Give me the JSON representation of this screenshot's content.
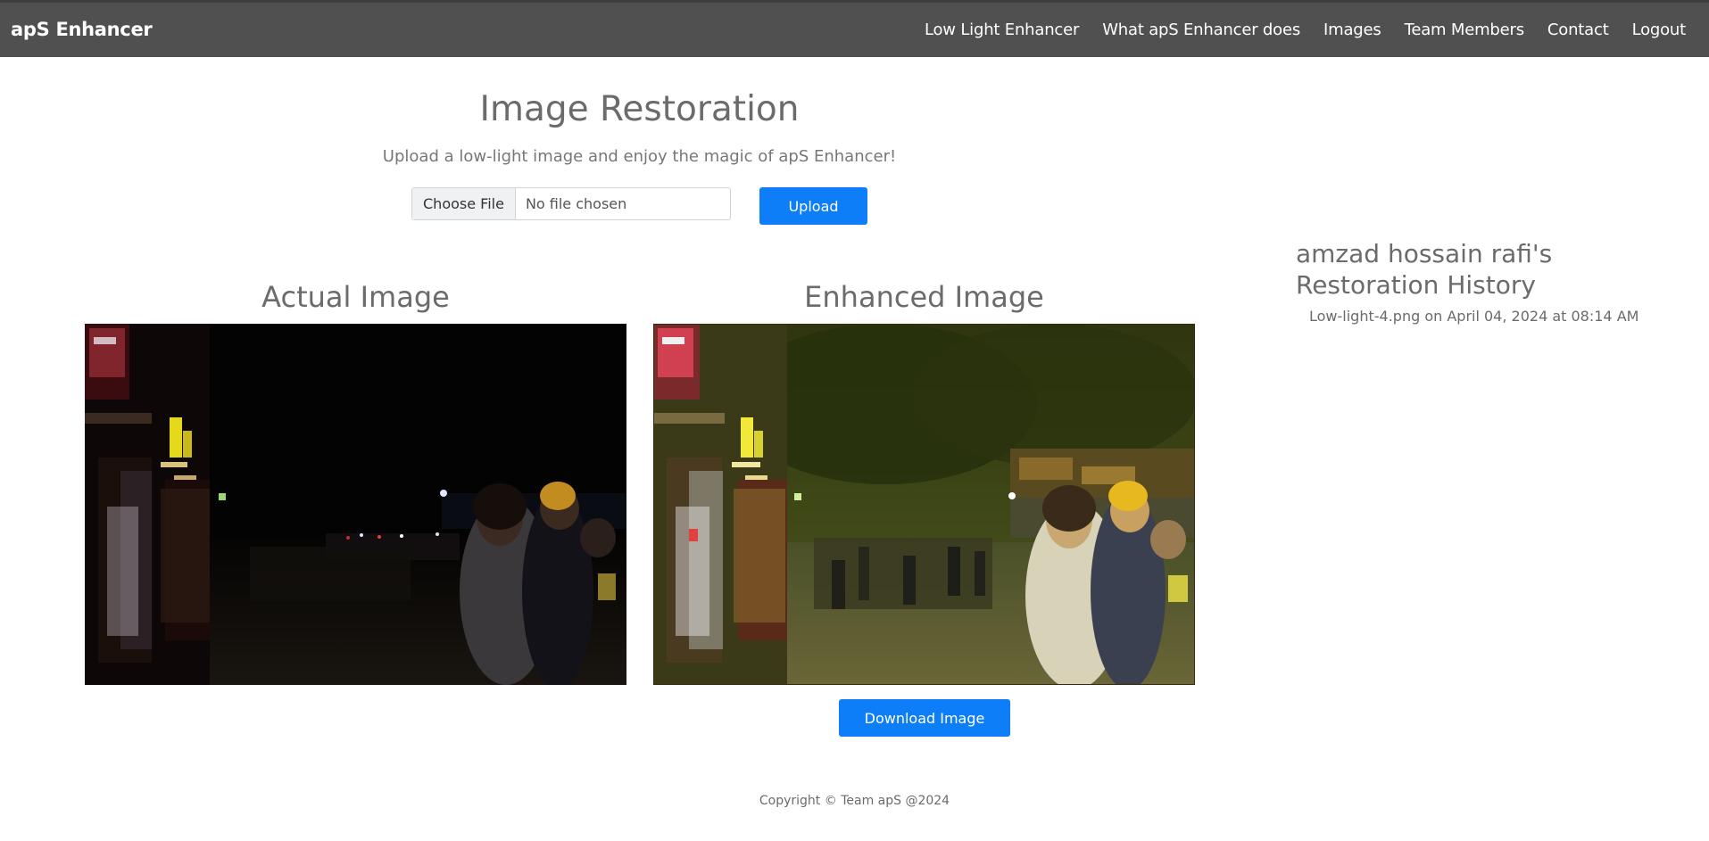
{
  "navbar": {
    "brand": "apS Enhancer",
    "links": [
      {
        "label": "Low Light Enhancer"
      },
      {
        "label": "What apS Enhancer does"
      },
      {
        "label": "Images"
      },
      {
        "label": "Team Members"
      },
      {
        "label": "Contact"
      },
      {
        "label": "Logout"
      }
    ]
  },
  "main": {
    "title": "Image Restoration",
    "subtitle": "Upload a low-light image and enjoy the magic of apS Enhancer!",
    "file_input": {
      "button_label": "Choose File",
      "status": "No file chosen"
    },
    "upload_label": "Upload",
    "actual_title": "Actual Image",
    "enhanced_title": "Enhanced Image",
    "download_label": "Download Image"
  },
  "history": {
    "title": "amzad hossain rafi's Restoration History",
    "items": [
      {
        "text": "Low-light-4.png on April 04, 2024 at 08:14 AM"
      }
    ]
  },
  "footer": {
    "text": "Copyright © Team apS @2024"
  },
  "colors": {
    "navbar_bg": "#505050",
    "accent_blue": "#0d7ef7",
    "text_gray": "#6b6b6b"
  }
}
